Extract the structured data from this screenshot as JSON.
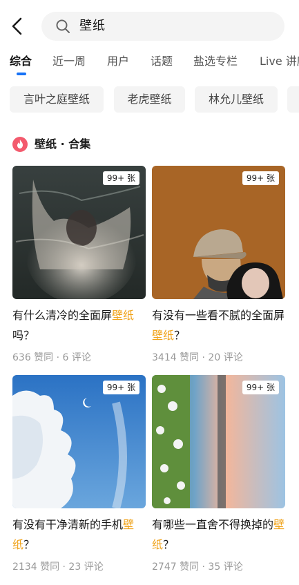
{
  "search": {
    "query": "壁纸"
  },
  "tabs": [
    {
      "label": "综合",
      "active": true
    },
    {
      "label": "近一周",
      "active": false
    },
    {
      "label": "用户",
      "active": false
    },
    {
      "label": "话题",
      "active": false
    },
    {
      "label": "盐选专栏",
      "active": false
    },
    {
      "label": "Live 讲座",
      "active": false
    }
  ],
  "chips": [
    {
      "label": "言叶之庭壁纸"
    },
    {
      "label": "老虎壁纸"
    },
    {
      "label": "林允儿壁纸"
    }
  ],
  "section": {
    "title": "壁纸 · 合集",
    "icon": "flame-icon",
    "icon_color": "#f35a6d"
  },
  "cards": [
    {
      "badge": "99+ 张",
      "title_pre": "有什么清冷的全面屏",
      "title_hl": "壁纸",
      "title_post": "吗？",
      "meta": "636 赞同 · 6 评论"
    },
    {
      "badge": "99+ 张",
      "title_pre": "有没有一些看不腻的全面屏",
      "title_hl": "壁纸",
      "title_post": "？",
      "meta": "3414 赞同 · 20 评论"
    },
    {
      "badge": "99+ 张",
      "title_pre": "有没有干净清新的手机",
      "title_hl": "壁纸",
      "title_post": "？",
      "meta": "2134 赞同 · 23 评论"
    },
    {
      "badge": "99+ 张",
      "title_pre": "有哪些一直舍不得换掉的",
      "title_hl": "壁纸",
      "title_post": "？",
      "meta": "2747 赞同 · 35 评论"
    }
  ],
  "colors": {
    "accent": "#1772f6",
    "highlight": "#f0a31a",
    "meta": "#999999"
  }
}
